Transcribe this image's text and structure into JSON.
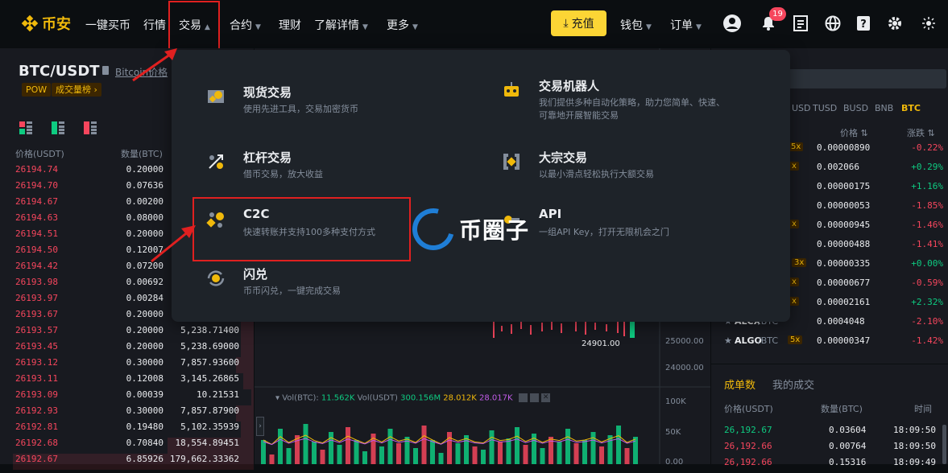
{
  "nav": {
    "logo": "币安",
    "items": [
      {
        "label": "一键买币",
        "dropdown": false
      },
      {
        "label": "行情",
        "dropdown": false
      },
      {
        "label": "交易",
        "dropdown": true,
        "active": true
      },
      {
        "label": "合约",
        "dropdown": true
      },
      {
        "label": "理财",
        "dropdown": false
      },
      {
        "label": "了解详情",
        "dropdown": true
      },
      {
        "label": "更多",
        "dropdown": true
      }
    ],
    "deposit_label": "充值",
    "wallet_label": "钱包",
    "orders_label": "订单",
    "notification_count": "19",
    "accent": "#fcd535"
  },
  "symbol": {
    "pair": "BTC/USDT",
    "link": "Bitcoin价格",
    "tags": [
      "POW",
      "成交量榜 ›"
    ]
  },
  "orderbook": {
    "headers": [
      "价格(USDT)",
      "数量(BTC)"
    ],
    "rows": [
      {
        "price": "26194.74",
        "qty": "0.20000",
        "total": "",
        "depth": 0.05
      },
      {
        "price": "26194.70",
        "qty": "0.07636",
        "total": "",
        "depth": 0.04
      },
      {
        "price": "26194.67",
        "qty": "0.00200",
        "total": "",
        "depth": 0.02
      },
      {
        "price": "26194.63",
        "qty": "0.08000",
        "total": "",
        "depth": 0.04
      },
      {
        "price": "26194.51",
        "qty": "0.20000",
        "total": "",
        "depth": 0.05
      },
      {
        "price": "26194.50",
        "qty": "0.12007",
        "total": "",
        "depth": 0.04
      },
      {
        "price": "26194.42",
        "qty": "0.07200",
        "total": "",
        "depth": 0.04
      },
      {
        "price": "26193.98",
        "qty": "0.00692",
        "total": "",
        "depth": 0.02
      },
      {
        "price": "26193.97",
        "qty": "0.00284",
        "total": "",
        "depth": 0.02
      },
      {
        "price": "26193.67",
        "qty": "0.20000",
        "total": "",
        "depth": 0.05
      },
      {
        "price": "26193.57",
        "qty": "0.20000",
        "total": "5,238.71400",
        "depth": 0.05
      },
      {
        "price": "26193.45",
        "qty": "0.20000",
        "total": "5,238.69000",
        "depth": 0.05
      },
      {
        "price": "26193.12",
        "qty": "0.30000",
        "total": "7,857.93600",
        "depth": 0.07
      },
      {
        "price": "26193.11",
        "qty": "0.12008",
        "total": "3,145.26865",
        "depth": 0.04
      },
      {
        "price": "26193.09",
        "qty": "0.00039",
        "total": "10.21531",
        "depth": 0.01
      },
      {
        "price": "26192.93",
        "qty": "0.30000",
        "total": "7,857.87900",
        "depth": 0.07
      },
      {
        "price": "26192.81",
        "qty": "0.19480",
        "total": "5,102.35939",
        "depth": 0.05
      },
      {
        "price": "26192.68",
        "qty": "0.70840",
        "total": "18,554.89451",
        "depth": 0.34
      },
      {
        "price": "26192.67",
        "qty": "6.85926",
        "total": "179,662.33362",
        "depth": 0.95
      }
    ]
  },
  "chart": {
    "price_label": "24901.00",
    "axis": [
      "25000.00",
      "24000.00"
    ],
    "volume_header": {
      "vol_btc_label": "Vol(BTC):",
      "vol_btc": "11.562K",
      "vol_usdt_label": "Vol(USDT)",
      "vol_usdt": "300.156M",
      "ma1": "28.012K",
      "ma2": "28.017K"
    },
    "vol_axis": [
      "100K",
      "50K",
      "0.00"
    ]
  },
  "markets": {
    "tabs": [
      "USD",
      "TUSD",
      "BUSD",
      "BNB",
      "BTC"
    ],
    "active_tab": "BTC",
    "headers": [
      "价格",
      "涨跌"
    ],
    "rows": [
      {
        "name": "",
        "quote": "",
        "lev": "5x",
        "price": "0.00000890",
        "chg": "-0.22%",
        "up": false
      },
      {
        "name": "",
        "quote": "",
        "lev": "x",
        "price": "0.002066",
        "chg": "+0.29%",
        "up": true
      },
      {
        "name": "",
        "quote": "",
        "lev": "",
        "price": "0.00000175",
        "chg": "+1.16%",
        "up": true
      },
      {
        "name": "",
        "quote": "",
        "lev": "",
        "price": "0.00000053",
        "chg": "-1.85%",
        "up": false
      },
      {
        "name": "",
        "quote": "",
        "lev": "x",
        "price": "0.00000945",
        "chg": "-1.46%",
        "up": false
      },
      {
        "name": "",
        "quote": "",
        "lev": "",
        "price": "0.00000488",
        "chg": "-1.41%",
        "up": false
      },
      {
        "name": "",
        "quote": "",
        "lev": "3x",
        "price": "0.00000335",
        "chg": "+0.00%",
        "up": true
      },
      {
        "name": "",
        "quote": "",
        "lev": "x",
        "price": "0.00000677",
        "chg": "-0.59%",
        "up": false
      },
      {
        "name": "",
        "quote": "",
        "lev": "x",
        "price": "0.00002161",
        "chg": "+2.32%",
        "up": true
      },
      {
        "name": "ALCX",
        "quote": "/BTC",
        "lev": "",
        "price": "0.0004048",
        "chg": "-2.10%",
        "up": false
      },
      {
        "name": "ALGO",
        "quote": "/BTC",
        "lev": "5x",
        "price": "0.00000347",
        "chg": "-1.42%",
        "up": false
      }
    ]
  },
  "trades": {
    "tabs": [
      "成单数",
      "我的成交"
    ],
    "headers": [
      "价格(USDT)",
      "数量(BTC)",
      "时间"
    ],
    "rows": [
      {
        "price": "26,192.67",
        "qty": "0.03604",
        "time": "18:09:50",
        "up": true
      },
      {
        "price": "26,192.66",
        "qty": "0.00764",
        "time": "18:09:50",
        "up": false
      },
      {
        "price": "26,192.66",
        "qty": "0.15316",
        "time": "18:09:49",
        "up": false
      }
    ]
  },
  "dropdown": {
    "items": [
      {
        "title": "现货交易",
        "desc": "使用先进工具，交易加密货币",
        "icon": "spot-trade-icon"
      },
      {
        "title": "交易机器人",
        "desc": "我们提供多种自动化策略，助力您简单、快速、可靠地开展智能交易",
        "icon": "trading-bot-icon"
      },
      {
        "title": "杠杆交易",
        "desc": "借币交易，放大收益",
        "icon": "margin-trade-icon"
      },
      {
        "title": "大宗交易",
        "desc": "以最小滑点轻松执行大额交易",
        "icon": "block-trade-icon"
      },
      {
        "title": "C2C",
        "desc": "快速转账并支持100多种支付方式",
        "icon": "c2c-icon"
      },
      {
        "title": "API",
        "desc": "一组API Key，打开无限机会之门",
        "icon": "api-icon"
      },
      {
        "title": "闪兑",
        "desc": "币币闪兑，一键完成交易",
        "icon": "convert-icon"
      }
    ]
  },
  "watermark": "币圈子"
}
